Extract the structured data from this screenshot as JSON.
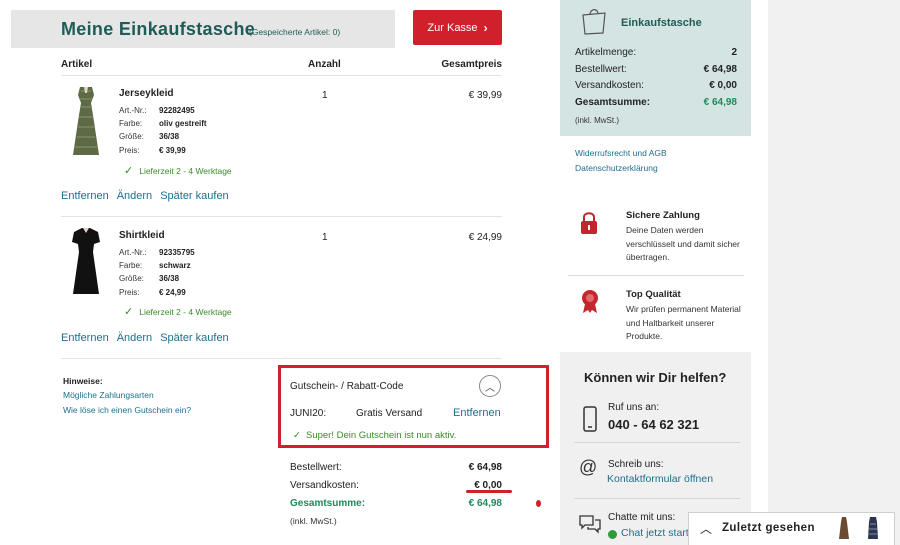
{
  "header": {
    "title": "Meine Einkaufstasche",
    "saved_items": "(Gespeicherte Artikel: 0)",
    "checkout_label": "Zur Kasse"
  },
  "table": {
    "col_article": "Artikel",
    "col_quantity": "Anzahl",
    "col_total": "Gesamtpreis"
  },
  "items": [
    {
      "name": "Jerseykleid",
      "specs": [
        {
          "label": "Art.-Nr.:",
          "value": "92282495"
        },
        {
          "label": "Farbe:",
          "value": "oliv gestreift"
        },
        {
          "label": "Größe:",
          "value": "36/38"
        },
        {
          "label": "Preis:",
          "value": "€ 39,99"
        }
      ],
      "delivery": "Lieferzeit 2 - 4 Werktage",
      "quantity": "1",
      "total": "€ 39,99",
      "actions": [
        "Entfernen",
        "Ändern",
        "Später kaufen"
      ]
    },
    {
      "name": "Shirtkleid",
      "specs": [
        {
          "label": "Art.-Nr.:",
          "value": "92335795"
        },
        {
          "label": "Farbe:",
          "value": "schwarz"
        },
        {
          "label": "Größe:",
          "value": "36/38"
        },
        {
          "label": "Preis:",
          "value": "€ 24,99"
        }
      ],
      "delivery": "Lieferzeit 2 - 4 Werktage",
      "quantity": "1",
      "total": "€ 24,99",
      "actions": [
        "Entfernen",
        "Ändern",
        "Später kaufen"
      ]
    }
  ],
  "hints": {
    "title": "Hinweise:",
    "links": [
      "Mögliche Zahlungsarten",
      "Wie löse ich einen Gutschein ein?"
    ]
  },
  "voucher": {
    "title": "Gutschein- / Rabatt-Code",
    "code": "JUNI20:",
    "description": "Gratis Versand",
    "remove": "Entfernen",
    "success": "Super! Dein Gutschein ist nun aktiv."
  },
  "totals": {
    "order_label": "Bestellwert:",
    "order_value": "€ 64,98",
    "shipping_label": "Versandkosten:",
    "shipping_value": "€ 0,00",
    "sum_label": "Gesamtsumme:",
    "sum_value": "€ 64,98",
    "vat_note": "(inkl. MwSt.)"
  },
  "summary": {
    "title": "Einkaufstasche",
    "rows": [
      {
        "label": "Artikelmenge:",
        "value": "2"
      },
      {
        "label": "Bestellwert:",
        "value": "€ 64,98"
      },
      {
        "label": "Versandkosten:",
        "value": "€ 0,00"
      },
      {
        "label": "Gesamtsumme:",
        "value": "€ 64,98"
      }
    ],
    "vat_note": "(inkl. MwSt.)",
    "links": [
      "Widerrufsrecht und AGB",
      "Datenschutzerklärung"
    ]
  },
  "features": [
    {
      "title": "Sichere Zahlung",
      "text": "Deine Daten werden verschlüsselt und damit sicher übertragen."
    },
    {
      "title": "Top Qualität",
      "text": "Wir prüfen permanent Material und Haltbarkeit unserer Produkte."
    }
  ],
  "help": {
    "title": "Können wir Dir helfen?",
    "call_label": "Ruf uns an:",
    "phone": "040 - 64 62 321",
    "write_label": "Schreib uns:",
    "contact_link": "Kontaktformular öffnen",
    "chat_label": "Chatte mit uns:",
    "chat_link": "Chat jetzt starten"
  },
  "recent": {
    "label": "Zuletzt gesehen"
  },
  "colors": {
    "brand_teal": "#1f5c57",
    "accent_red": "#d0202c",
    "link_blue": "#1f6e8c",
    "success_green": "#3a8a2a"
  }
}
